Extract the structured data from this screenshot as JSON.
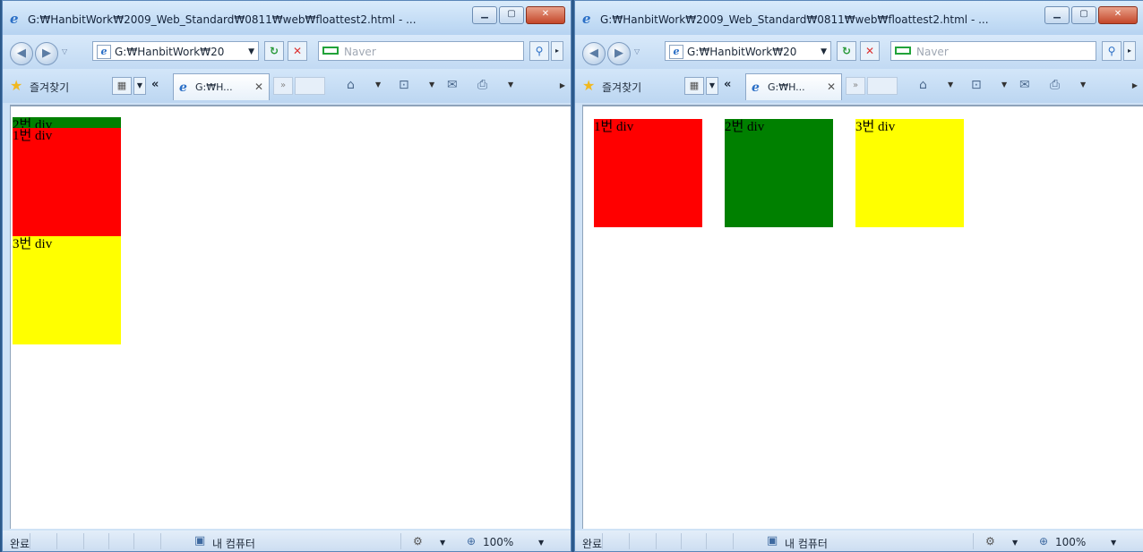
{
  "windows": [
    {
      "id": "left",
      "title": "G:₩HanbitWork₩2009_Web_Standard₩0811₩web₩floattest2.html - ...",
      "address": "G:₩HanbitWork₩20",
      "search_placeholder": "Naver",
      "favorites_label": "즐겨찾기",
      "tab_title": "G:₩H...",
      "status_text": "완료",
      "zone": "내 컴퓨터",
      "zoom": "100%",
      "divs": [
        {
          "label": "1번 div",
          "color": "#ff0000"
        },
        {
          "label": "2번 div",
          "color": "#008000"
        },
        {
          "label": "3번 div",
          "color": "#ffff00"
        }
      ]
    },
    {
      "id": "right",
      "title": "G:₩HanbitWork₩2009_Web_Standard₩0811₩web₩floattest2.html - ...",
      "address": "G:₩HanbitWork₩20",
      "search_placeholder": "Naver",
      "favorites_label": "즐겨찾기",
      "tab_title": "G:₩H...",
      "status_text": "완료",
      "zone": "내 컴퓨터",
      "zoom": "100%",
      "divs": [
        {
          "label": "1번 div",
          "color": "#ff0000"
        },
        {
          "label": "2번 div",
          "color": "#008000"
        },
        {
          "label": "3번 div",
          "color": "#ffff00"
        }
      ]
    }
  ],
  "icons": {
    "back": "back-arrow-icon",
    "forward": "forward-arrow-icon",
    "refresh": "refresh-icon",
    "stop": "stop-icon",
    "search": "search-icon",
    "favorites": "star-icon",
    "home": "home-icon",
    "feeds": "rss-icon",
    "mail": "mail-icon",
    "print": "printer-icon",
    "zone": "computer-icon",
    "zoom": "zoom-icon"
  }
}
